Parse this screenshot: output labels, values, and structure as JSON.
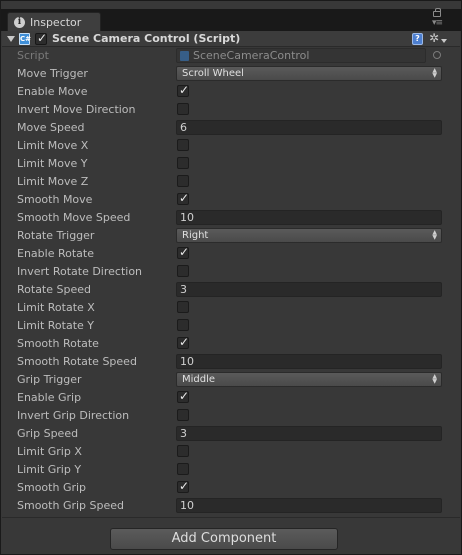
{
  "tab": {
    "label": "Inspector",
    "icon": "info-icon"
  },
  "component": {
    "title": "Scene Camera Control (Script)",
    "enabled": true,
    "icons": [
      "cs-script-icon",
      "help-icon",
      "gear-icon"
    ]
  },
  "script_row": {
    "label": "Script",
    "value": "SceneCameraControl"
  },
  "properties": [
    {
      "label": "Move Trigger",
      "kind": "dropdown",
      "value": "Scroll Wheel"
    },
    {
      "label": "Enable Move",
      "kind": "checkbox",
      "checked": true
    },
    {
      "label": "Invert Move Direction",
      "kind": "checkbox",
      "checked": false
    },
    {
      "label": "Move Speed",
      "kind": "number",
      "value": "6"
    },
    {
      "label": "Limit Move X",
      "kind": "checkbox",
      "checked": false
    },
    {
      "label": "Limit Move Y",
      "kind": "checkbox",
      "checked": false
    },
    {
      "label": "Limit Move Z",
      "kind": "checkbox",
      "checked": false
    },
    {
      "label": "Smooth Move",
      "kind": "checkbox",
      "checked": true
    },
    {
      "label": "Smooth Move Speed",
      "kind": "number",
      "value": "10"
    },
    {
      "label": "Rotate Trigger",
      "kind": "dropdown",
      "value": "Right"
    },
    {
      "label": "Enable Rotate",
      "kind": "checkbox",
      "checked": true
    },
    {
      "label": "Invert Rotate Direction",
      "kind": "checkbox",
      "checked": false
    },
    {
      "label": "Rotate Speed",
      "kind": "number",
      "value": "3"
    },
    {
      "label": "Limit Rotate X",
      "kind": "checkbox",
      "checked": false
    },
    {
      "label": "Limit Rotate Y",
      "kind": "checkbox",
      "checked": false
    },
    {
      "label": "Smooth Rotate",
      "kind": "checkbox",
      "checked": true
    },
    {
      "label": "Smooth Rotate Speed",
      "kind": "number",
      "value": "10"
    },
    {
      "label": "Grip Trigger",
      "kind": "dropdown",
      "value": "Middle"
    },
    {
      "label": "Enable Grip",
      "kind": "checkbox",
      "checked": true
    },
    {
      "label": "Invert Grip Direction",
      "kind": "checkbox",
      "checked": false
    },
    {
      "label": "Grip Speed",
      "kind": "number",
      "value": "3"
    },
    {
      "label": "Limit Grip X",
      "kind": "checkbox",
      "checked": false
    },
    {
      "label": "Limit Grip Y",
      "kind": "checkbox",
      "checked": false
    },
    {
      "label": "Smooth Grip",
      "kind": "checkbox",
      "checked": true
    },
    {
      "label": "Smooth Grip Speed",
      "kind": "number",
      "value": "10"
    }
  ],
  "footer": {
    "add_component_label": "Add Component"
  },
  "colors": {
    "panel": "#383838",
    "field": "#2a2a2a",
    "label": "#bdbdbd",
    "script_icon": "#3f8fd8"
  }
}
